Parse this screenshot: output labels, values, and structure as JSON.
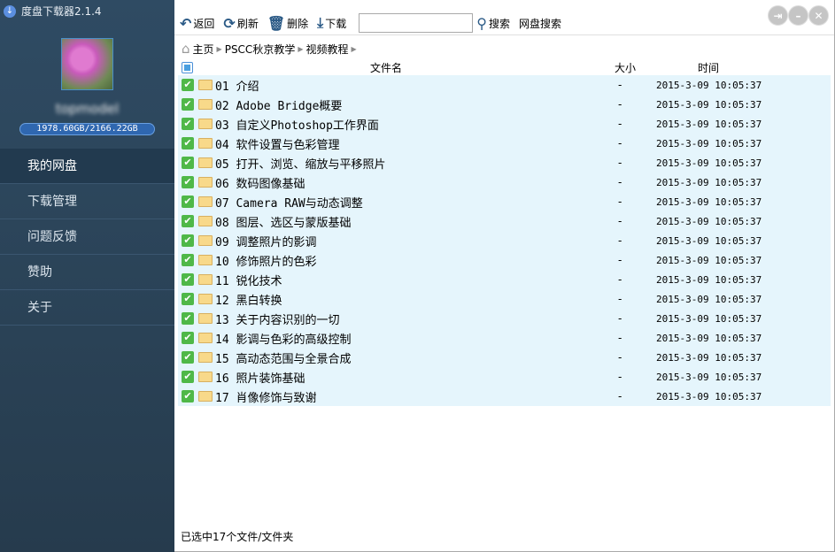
{
  "app": {
    "title": "度盘下载器2.1.4"
  },
  "sidebar": {
    "username": "topmodel",
    "quota": "1978.60GB/2166.22GB",
    "items": [
      {
        "label": "我的网盘"
      },
      {
        "label": "下载管理"
      },
      {
        "label": "问题反馈"
      },
      {
        "label": "赞助"
      },
      {
        "label": "关于"
      }
    ]
  },
  "toolbar": {
    "back": "返回",
    "refresh": "刷新",
    "delete": "删除",
    "download": "下载",
    "search_value": "",
    "search": "搜索",
    "pan_search": "网盘搜索"
  },
  "breadcrumb": [
    "主页",
    "PSCC秋京教学",
    "视频教程"
  ],
  "columns": {
    "name": "文件名",
    "size": "大小",
    "time": "时间"
  },
  "files": [
    {
      "name": "01 介绍",
      "size": "-",
      "time": "2015-3-09 10:05:37"
    },
    {
      "name": "02 Adobe Bridge概要",
      "size": "-",
      "time": "2015-3-09 10:05:37"
    },
    {
      "name": "03 自定义Photoshop工作界面",
      "size": "-",
      "time": "2015-3-09 10:05:37"
    },
    {
      "name": "04 软件设置与色彩管理",
      "size": "-",
      "time": "2015-3-09 10:05:37"
    },
    {
      "name": "05 打开、浏览、缩放与平移照片",
      "size": "-",
      "time": "2015-3-09 10:05:37"
    },
    {
      "name": "06 数码图像基础",
      "size": "-",
      "time": "2015-3-09 10:05:37"
    },
    {
      "name": "07 Camera RAW与动态调整",
      "size": "-",
      "time": "2015-3-09 10:05:37"
    },
    {
      "name": "08 图层、选区与蒙版基础",
      "size": "-",
      "time": "2015-3-09 10:05:37"
    },
    {
      "name": "09 调整照片的影调",
      "size": "-",
      "time": "2015-3-09 10:05:37"
    },
    {
      "name": "10 修饰照片的色彩",
      "size": "-",
      "time": "2015-3-09 10:05:37"
    },
    {
      "name": "11 锐化技术",
      "size": "-",
      "time": "2015-3-09 10:05:37"
    },
    {
      "name": "12 黑白转换",
      "size": "-",
      "time": "2015-3-09 10:05:37"
    },
    {
      "name": "13 关于内容识别的一切",
      "size": "-",
      "time": "2015-3-09 10:05:37"
    },
    {
      "name": "14 影调与色彩的高级控制",
      "size": "-",
      "time": "2015-3-09 10:05:37"
    },
    {
      "name": "15 高动态范围与全景合成",
      "size": "-",
      "time": "2015-3-09 10:05:37"
    },
    {
      "name": "16 照片装饰基础",
      "size": "-",
      "time": "2015-3-09 10:05:37"
    },
    {
      "name": "17 肖像修饰与致谢",
      "size": "-",
      "time": "2015-3-09 10:05:37"
    }
  ],
  "status": "已选中17个文件/文件夹"
}
